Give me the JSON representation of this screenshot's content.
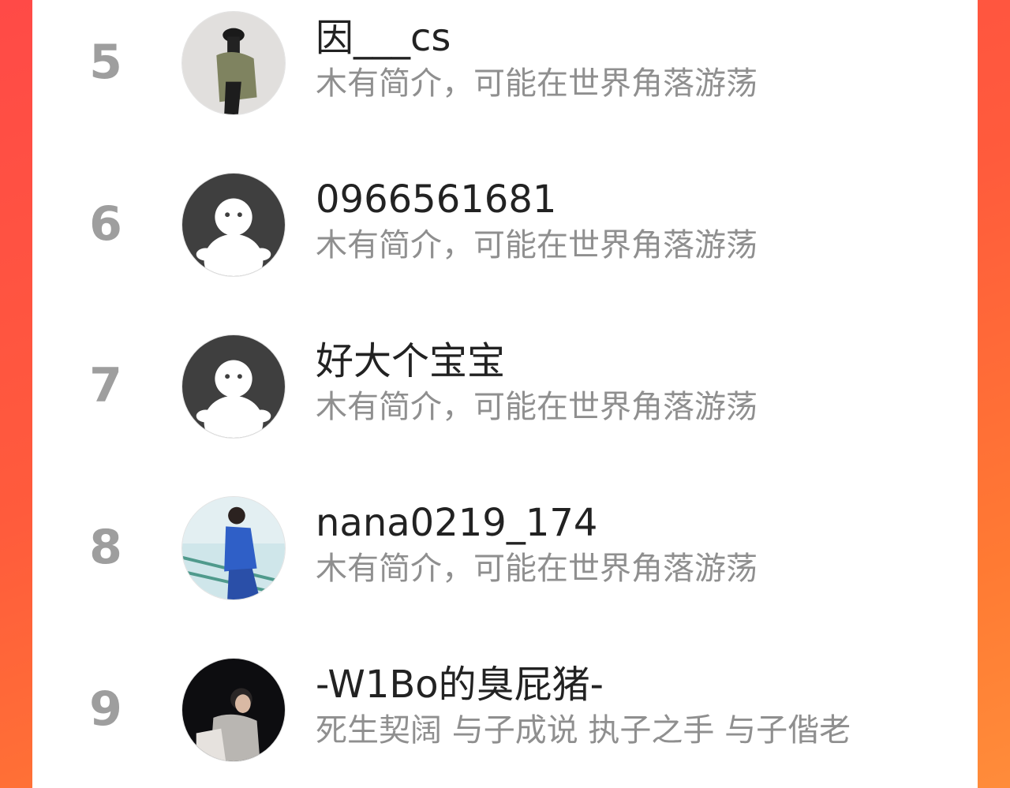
{
  "ranking": {
    "items": [
      {
        "rank": "5",
        "name": "因___cs",
        "bio": "木有简介，可能在世界角落游荡",
        "avatar": "photo-person-cap-icon"
      },
      {
        "rank": "6",
        "name": "0966561681",
        "bio": "木有简介，可能在世界角落游荡",
        "avatar": "default-ghost-avatar-icon"
      },
      {
        "rank": "7",
        "name": "好大个宝宝",
        "bio": "木有简介，可能在世界角落游荡",
        "avatar": "default-ghost-avatar-icon"
      },
      {
        "rank": "8",
        "name": "nana0219_174",
        "bio": "木有简介，可能在世界角落游荡",
        "avatar": "photo-person-blue-jacket-icon"
      },
      {
        "rank": "9",
        "name": "-W1Bo的臭屁猪-",
        "bio": "死生契阔 与子成说 执子之手 与子偕老",
        "avatar": "photo-person-dark-stage-icon"
      }
    ]
  },
  "colors": {
    "background_gradient_start": "#ff4a47",
    "background_gradient_end": "#ff8c3a",
    "rank_text": "#9e9e9e",
    "name_text": "#222222",
    "bio_text": "#8f8f8f"
  }
}
